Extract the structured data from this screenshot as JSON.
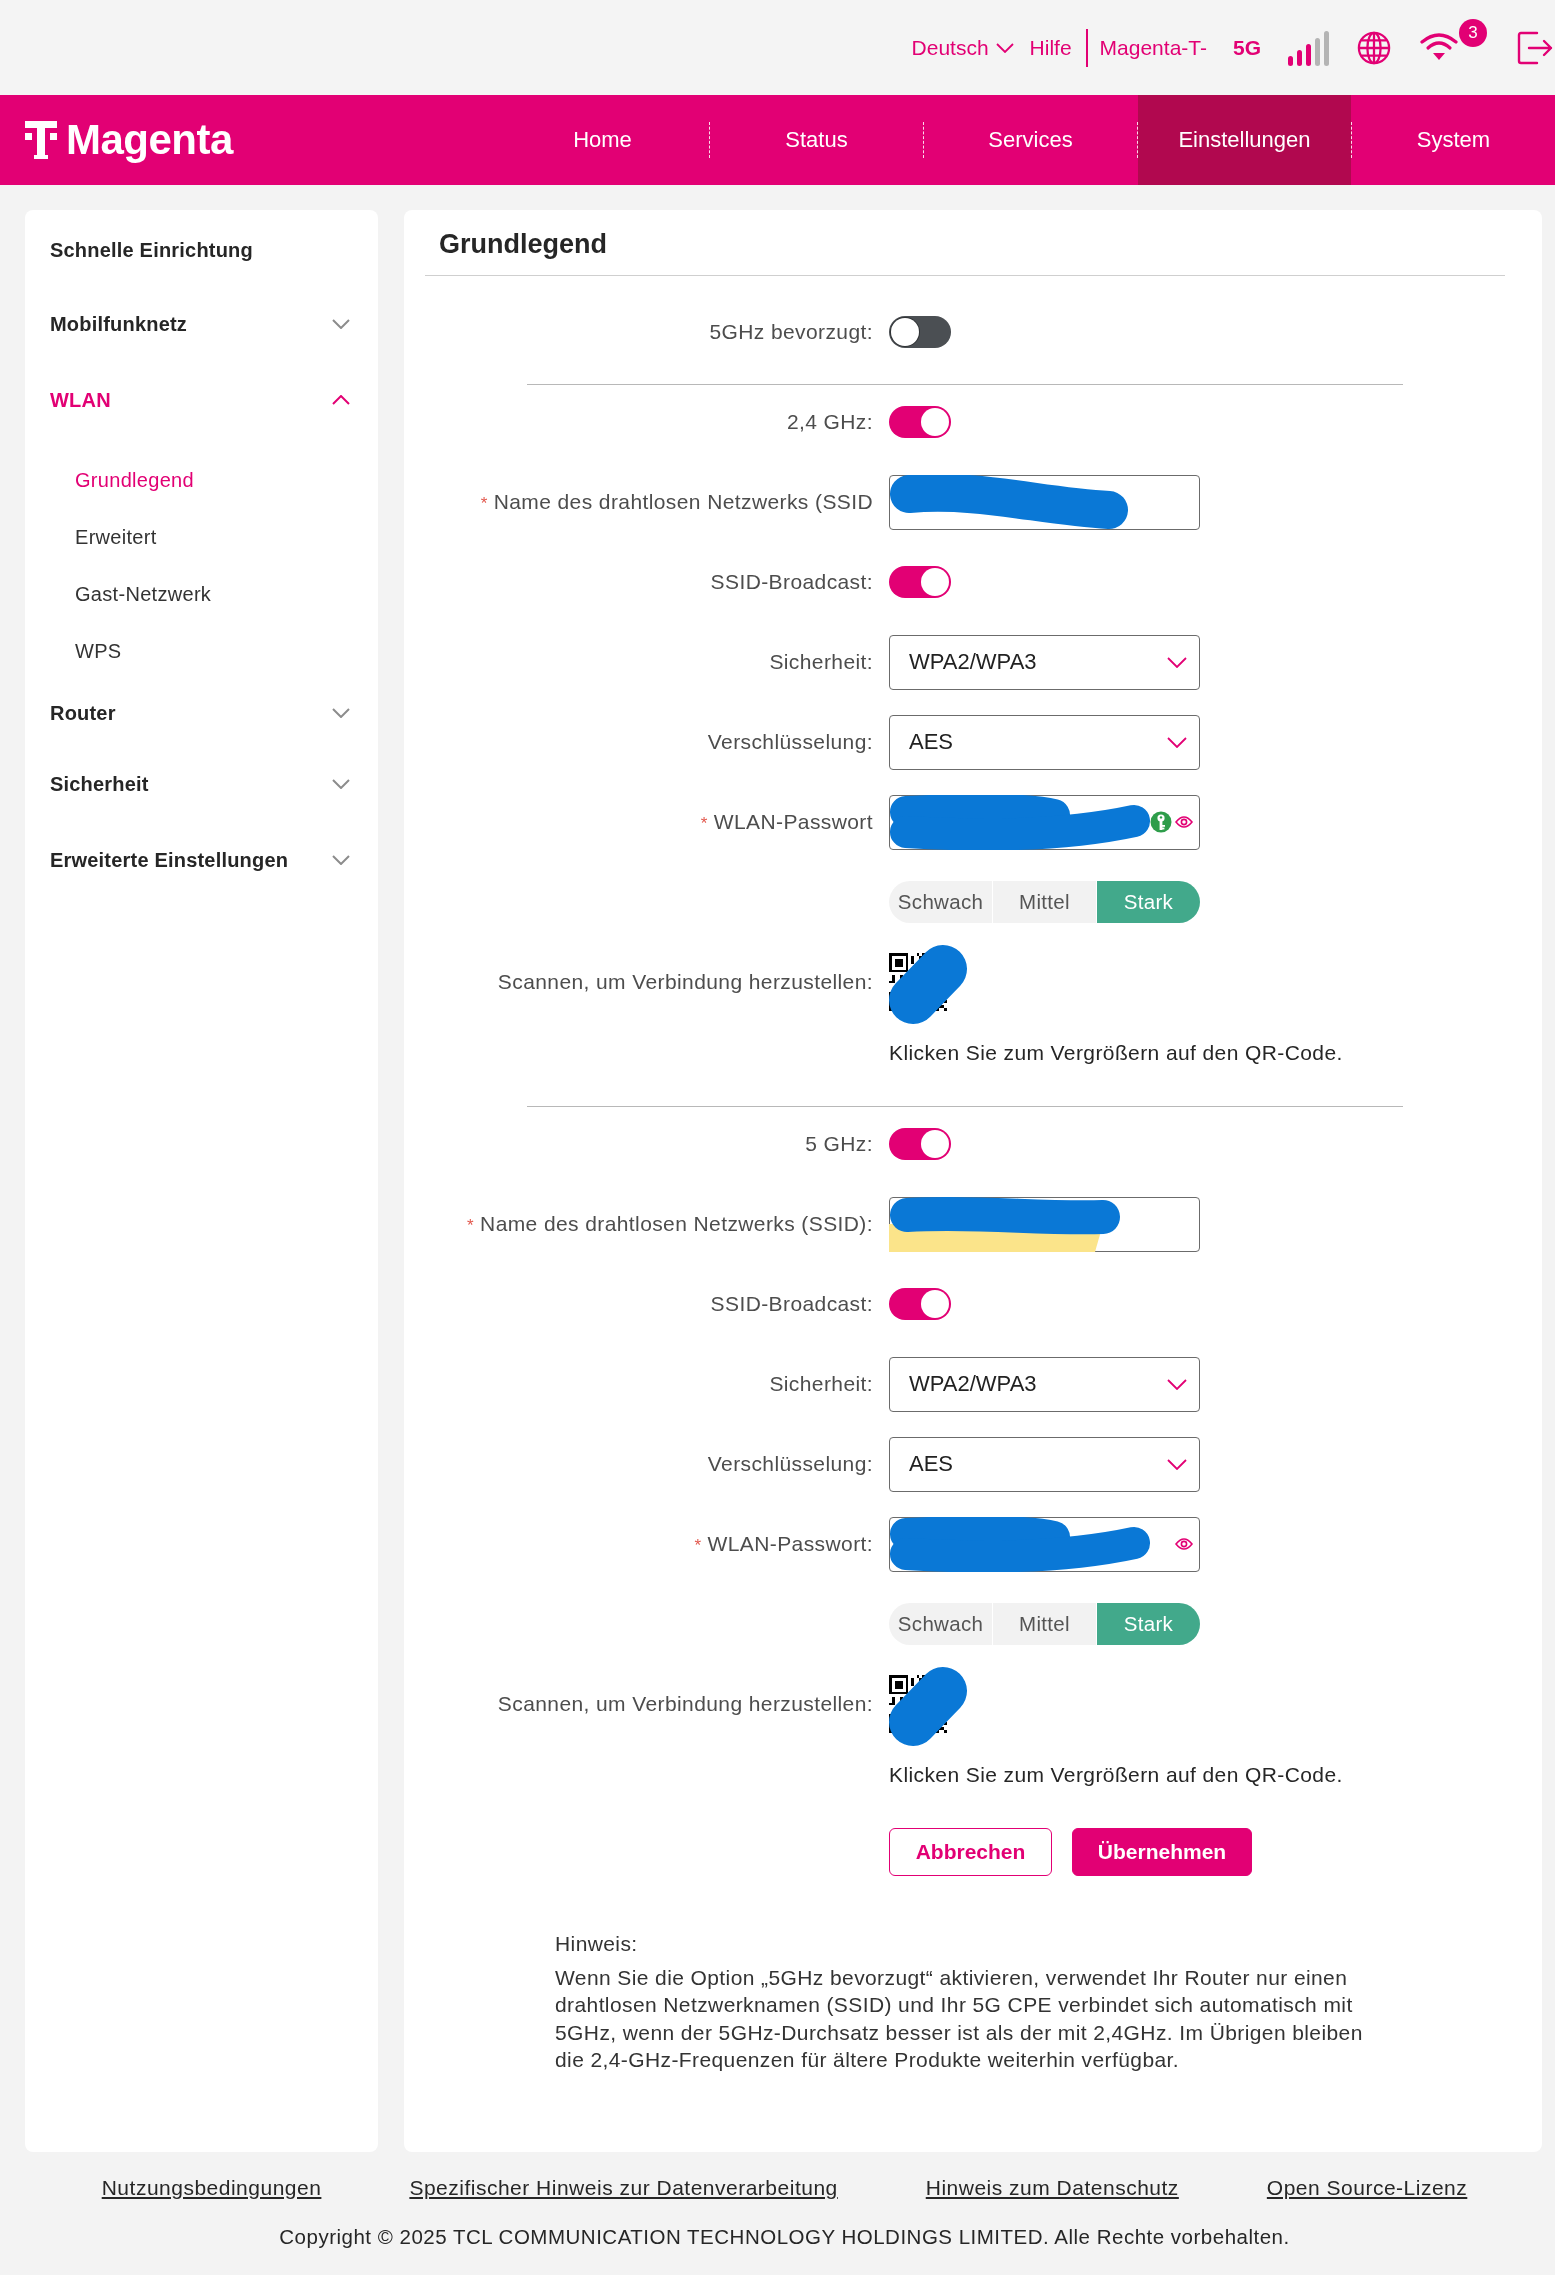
{
  "top_bar": {
    "language": "Deutsch",
    "help": "Hilfe",
    "operator": "Magenta-T-",
    "network": "5G",
    "notification_count": "3"
  },
  "nav": {
    "logo": "Magenta",
    "items": [
      {
        "label": "Home",
        "selected": false
      },
      {
        "label": "Status",
        "selected": false
      },
      {
        "label": "Services",
        "selected": false
      },
      {
        "label": "Einstellungen",
        "selected": true
      },
      {
        "label": "System",
        "selected": false
      }
    ]
  },
  "sidebar": {
    "items": [
      {
        "label": "Schnelle Einrichtung",
        "kind": "link",
        "selected": false
      },
      {
        "label": "Mobilfunknetz",
        "kind": "group",
        "expanded": false,
        "selected": false
      },
      {
        "label": "WLAN",
        "kind": "group",
        "expanded": true,
        "selected": true,
        "children": [
          {
            "label": "Grundlegend",
            "selected": true
          },
          {
            "label": "Erweitert",
            "selected": false
          },
          {
            "label": "Gast-Netzwerk",
            "selected": false
          },
          {
            "label": "WPS",
            "selected": false
          }
        ]
      },
      {
        "label": "Router",
        "kind": "group",
        "expanded": false,
        "selected": false
      },
      {
        "label": "Sicherheit",
        "kind": "group",
        "expanded": false,
        "selected": false
      },
      {
        "label": "Erweiterte Einstellungen",
        "kind": "group",
        "expanded": false,
        "selected": false
      }
    ]
  },
  "panel": {
    "title": "Grundlegend",
    "sections": [
      {
        "rows": [
          {
            "kind": "toggle",
            "label": "5GHz bevorzugt:",
            "on": false
          }
        ]
      },
      {
        "rows": [
          {
            "kind": "toggle",
            "label": "2,4 GHz:",
            "on": true
          },
          {
            "kind": "text",
            "label": "Name des drahtlosen Netzwerks (SSID",
            "required_mark": "*",
            "redacted": true
          },
          {
            "kind": "toggle",
            "label": "SSID-Broadcast:",
            "on": true
          },
          {
            "kind": "select",
            "label": "Sicherheit:",
            "value": "WPA2/WPA3"
          },
          {
            "kind": "select",
            "label": "Verschlüsselung:",
            "value": "AES"
          },
          {
            "kind": "password",
            "label": "WLAN-Passwort",
            "required_mark": "*",
            "redacted": true,
            "password_manager_badge": true
          },
          {
            "kind": "strength",
            "levels": [
              {
                "label": "Schwach",
                "selected": false
              },
              {
                "label": "Mittel",
                "selected": false
              },
              {
                "label": "Stark",
                "selected": true
              }
            ]
          },
          {
            "kind": "qr",
            "label": "Scannen, um Verbindung herzustellen:",
            "redacted": true,
            "hint": "Klicken Sie zum Vergrößern auf den QR-Code."
          }
        ]
      },
      {
        "rows": [
          {
            "kind": "toggle",
            "label": "5 GHz:",
            "on": true
          },
          {
            "kind": "text",
            "label": "Name des drahtlosen Netzwerks (SSID):",
            "required_mark": "*",
            "redacted": true,
            "highlighted": true
          },
          {
            "kind": "toggle",
            "label": "SSID-Broadcast:",
            "on": true
          },
          {
            "kind": "select",
            "label": "Sicherheit:",
            "value": "WPA2/WPA3"
          },
          {
            "kind": "select",
            "label": "Verschlüsselung:",
            "value": "AES"
          },
          {
            "kind": "password",
            "label": "WLAN-Passwort:",
            "required_mark": "*",
            "redacted": true
          },
          {
            "kind": "strength",
            "levels": [
              {
                "label": "Schwach",
                "selected": false
              },
              {
                "label": "Mittel",
                "selected": false
              },
              {
                "label": "Stark",
                "selected": true
              }
            ]
          },
          {
            "kind": "qr",
            "label": "Scannen, um Verbindung herzustellen:",
            "redacted": true,
            "hint": "Klicken Sie zum Vergrößern auf den QR-Code."
          }
        ]
      }
    ],
    "buttons": [
      {
        "label": "Abbrechen",
        "kind": "secondary"
      },
      {
        "label": "Übernehmen",
        "kind": "primary"
      }
    ],
    "note": {
      "title": "Hinweis:",
      "text": "Wenn Sie die Option „5GHz bevorzugt“ aktivieren, verwendet Ihr Router nur einen drahtlosen Netzwerknamen (SSID) und Ihr 5G CPE verbindet sich automatisch mit 5GHz, wenn der 5GHz-Durchsatz besser ist als der mit 2,4GHz. Im Übrigen bleiben die 2,4-GHz-Frequenzen für ältere Produkte weiterhin verfügbar."
    }
  },
  "footer": {
    "links": [
      "Nutzungsbedingungen",
      "Spezifischer Hinweis zur Datenverarbeitung",
      "Hinweis zum Datenschutz",
      "Open Source-Lizenz"
    ],
    "copyright": "Copyright © 2025 TCL COMMUNICATION TECHNOLOGY HOLDINGS LIMITED. Alle Rechte vorbehalten."
  }
}
